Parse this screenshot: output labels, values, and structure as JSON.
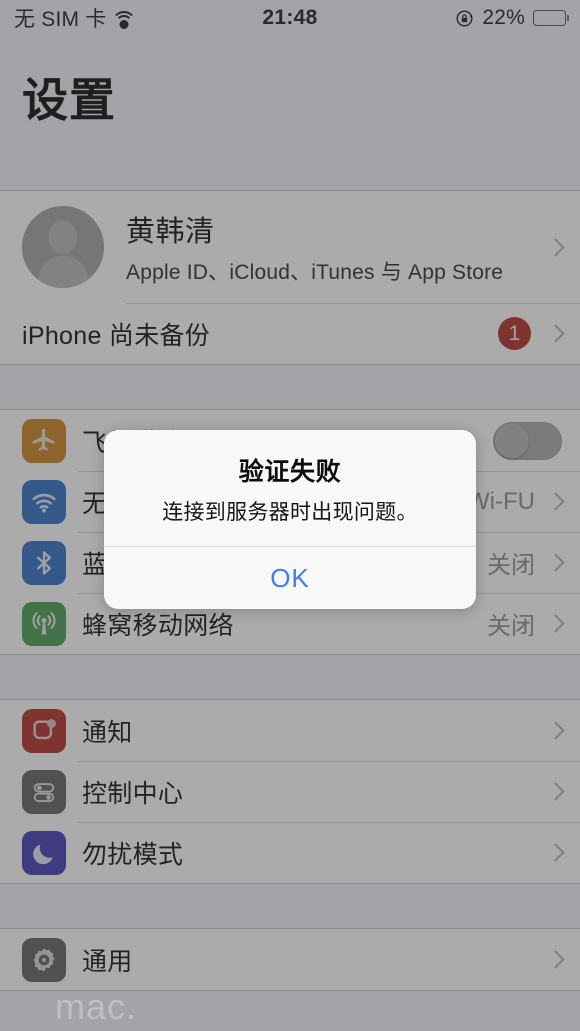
{
  "status_bar": {
    "carrier": "无 SIM 卡",
    "wifi_icon": "wifi-icon",
    "time": "21:48",
    "rotation_lock_icon": "rotation-lock-icon",
    "battery_percent": "22%",
    "battery_level": 22
  },
  "header": {
    "title": "设置"
  },
  "account": {
    "name": "黄韩清",
    "subtitle": "Apple ID、iCloud、iTunes 与 App Store",
    "avatar_icon": "person-avatar-icon"
  },
  "backup": {
    "label": "iPhone 尚未备份",
    "badge": "1"
  },
  "groups": [
    {
      "name": "connectivity",
      "rows": [
        {
          "label": "飞行模式",
          "icon": "airplane-icon",
          "icon_color": "#ff9500",
          "accessory": "toggle",
          "toggle_on": false
        },
        {
          "label": "无线局域网",
          "icon": "wifi-icon",
          "icon_color": "#2d7ae5",
          "accessory": "value",
          "value": "Wi-FU"
        },
        {
          "label": "蓝牙",
          "icon": "bluetooth-icon",
          "icon_color": "#2d7ae5",
          "accessory": "value",
          "value": "关闭"
        },
        {
          "label": "蜂窝移动网络",
          "icon": "cellular-icon",
          "icon_color": "#4cd964",
          "accessory": "value",
          "value": "关闭"
        }
      ]
    },
    {
      "name": "system-alerts",
      "rows": [
        {
          "label": "通知",
          "icon": "notifications-icon",
          "icon_color": "#ff3b30",
          "accessory": "chevron"
        },
        {
          "label": "控制中心",
          "icon": "control-center-icon",
          "icon_color": "#8e8e93",
          "accessory": "chevron"
        },
        {
          "label": "勿扰模式",
          "icon": "do-not-disturb-icon",
          "icon_color": "#5856d6",
          "accessory": "chevron"
        }
      ]
    },
    {
      "name": "general",
      "rows": [
        {
          "label": "通用",
          "icon": "gear-icon",
          "icon_color": "#8e8e93",
          "accessory": "chevron"
        }
      ]
    }
  ],
  "alert": {
    "title": "验证失败",
    "message": "连接到服务器时出现问题。",
    "ok_label": "OK",
    "accent_color": "#3d7ef0"
  },
  "watermark": {
    "text": "mac."
  }
}
